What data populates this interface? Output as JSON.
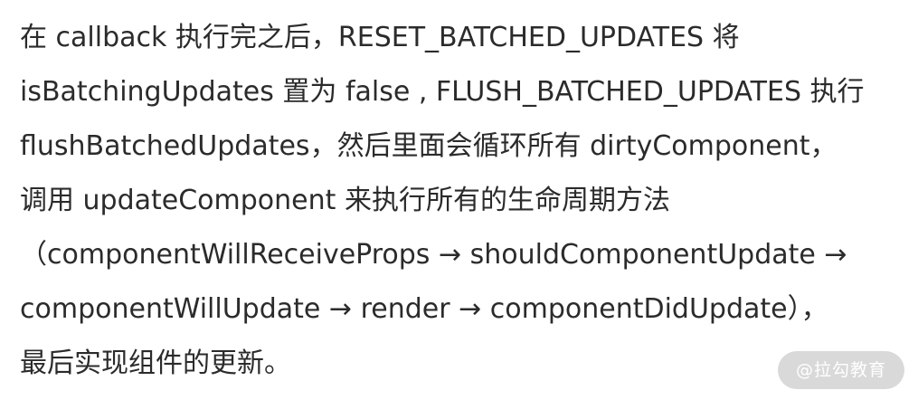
{
  "paragraph": {
    "lines": [
      "在 callback 执行完之后，RESET_BATCHED_UPDATES 将",
      "isBatchingUpdates 置为 false , FLUSH_BATCHED_UPDATES 执行",
      "flushBatchedUpdates，然后里面会循环所有 dirtyComponent，",
      "调用 updateComponent 来执行所有的生命周期方法",
      "（componentWillReceiveProps → shouldComponentUpdate →",
      "componentWillUpdate → render → componentDidUpdate），",
      "最后实现组件的更新。"
    ]
  },
  "watermark": {
    "text": "@拉勾教育"
  }
}
